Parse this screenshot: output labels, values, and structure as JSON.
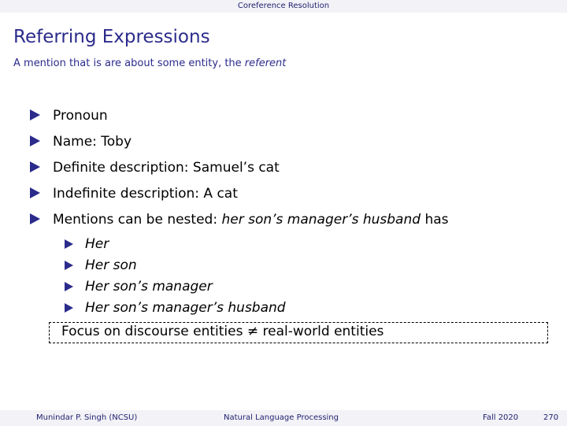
{
  "header": {
    "section": "Coreference Resolution"
  },
  "slide": {
    "title": "Referring Expressions",
    "subtitle_prefix": "A mention that is are about some entity, the ",
    "subtitle_emph": "referent",
    "items": [
      {
        "text": "Pronoun"
      },
      {
        "text": "Name: Toby"
      },
      {
        "text": "Definite description: Samuel’s cat"
      },
      {
        "text": "Indefinite description: A cat"
      },
      {
        "prefix": "Mentions can be nested: ",
        "emph": "her son’s manager’s husband",
        "suffix": " has"
      }
    ],
    "subitems": [
      "Her",
      "Her son",
      "Her son’s manager",
      "Her son’s manager’s husband"
    ],
    "focus": "Focus on discourse entities ≠ real-world entities"
  },
  "footer": {
    "author": "Munindar P. Singh  (NCSU)",
    "course": "Natural Language Processing",
    "term": "Fall 2020",
    "page": "270"
  },
  "colors": {
    "title": "#2b2b8c",
    "bullet": "#2b2b8c",
    "bar_background": "#f2f2f7"
  }
}
